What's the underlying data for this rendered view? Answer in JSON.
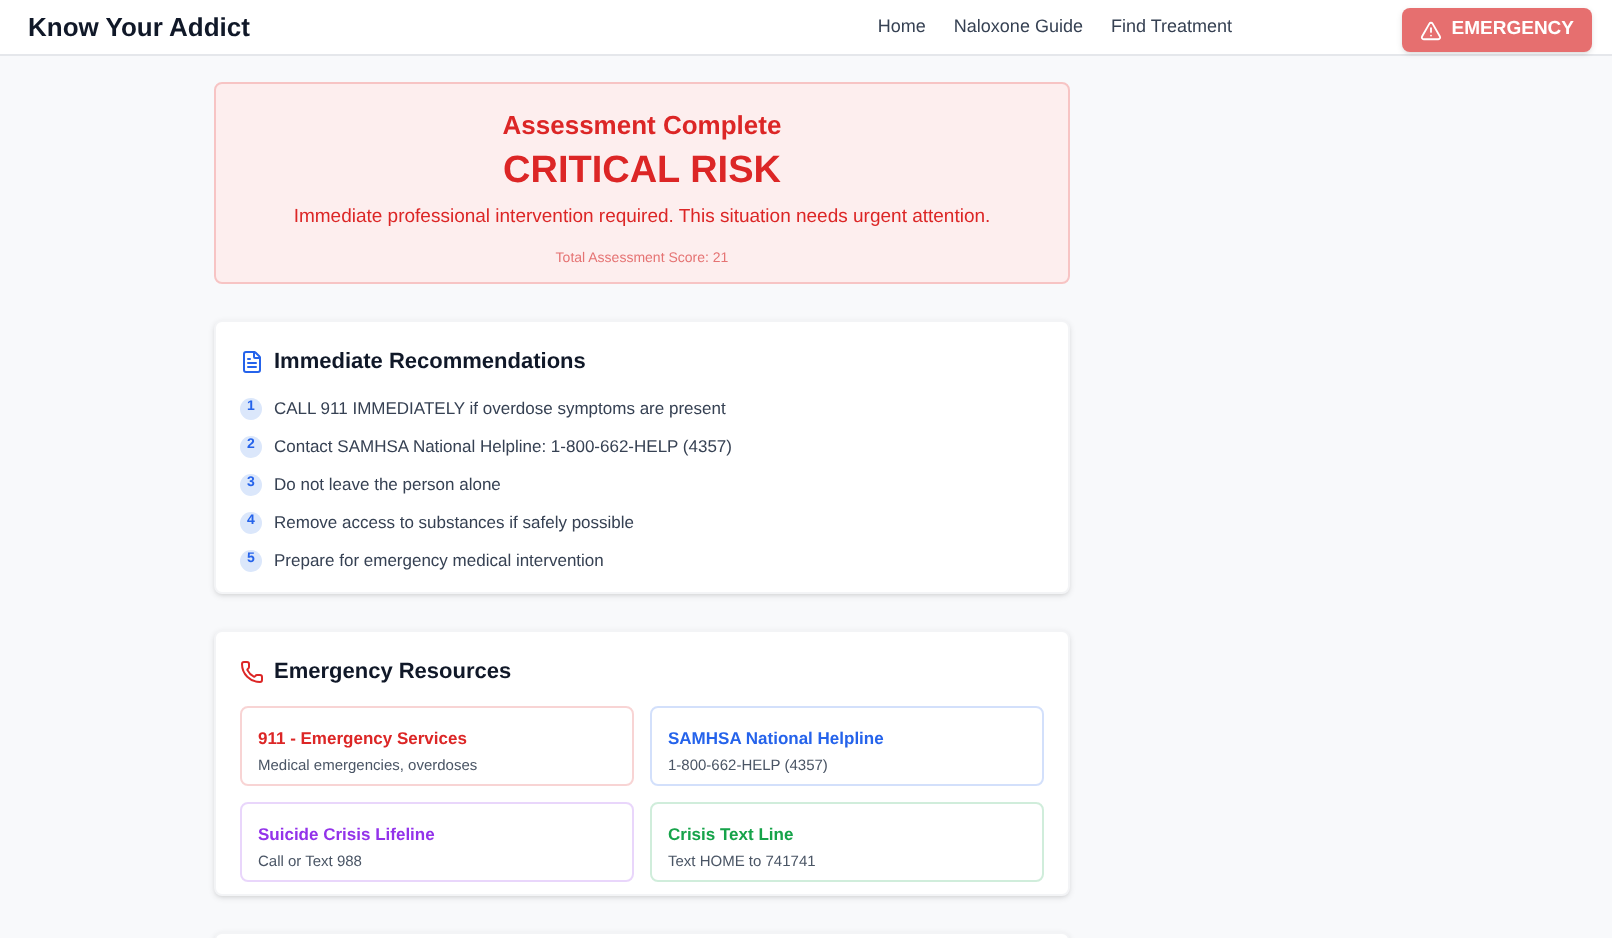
{
  "navbar": {
    "brand": "Know Your Addict",
    "links": [
      "Home",
      "Naloxone Guide",
      "Find Treatment"
    ],
    "emergency_button": "EMERGENCY"
  },
  "result": {
    "heading": "Assessment Complete",
    "risk_level": "CRITICAL RISK",
    "message": "Immediate professional intervention required. This situation needs urgent attention.",
    "score": "Total Assessment Score: 21"
  },
  "recommendations": {
    "title": "Immediate Recommendations",
    "items": [
      {
        "number": "1",
        "text": "CALL 911 IMMEDIATELY if overdose symptoms are present"
      },
      {
        "number": "2",
        "text": "Contact SAMHSA National Helpline: 1-800-662-HELP (4357)"
      },
      {
        "number": "3",
        "text": "Do not leave the person alone"
      },
      {
        "number": "4",
        "text": "Remove access to substances if safely possible"
      },
      {
        "number": "5",
        "text": "Prepare for emergency medical intervention"
      }
    ]
  },
  "resources": {
    "title": "Emergency Resources",
    "items": [
      {
        "name": "911 - Emergency Services",
        "detail": "Medical emergencies, overdoses",
        "color": "#dc2626"
      },
      {
        "name": "SAMHSA National Helpline",
        "detail": "1-800-662-HELP (4357)",
        "color": "#2563eb"
      },
      {
        "name": "Suicide Crisis Lifeline",
        "detail": "Call or Text 988",
        "color": "#9333ea"
      },
      {
        "name": "Crisis Text Line",
        "detail": "Text HOME to 741741",
        "color": "#16a34a"
      }
    ]
  }
}
